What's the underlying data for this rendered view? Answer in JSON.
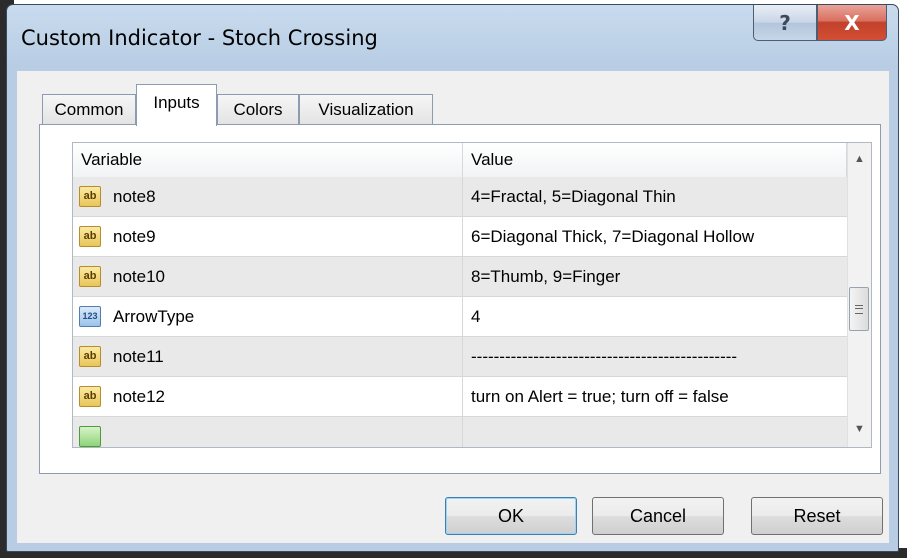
{
  "window": {
    "title": "Custom Indicator - Stoch Crossing",
    "help_glyph": "?",
    "close_glyph": "X"
  },
  "tabs": [
    {
      "label": "Common",
      "active": false
    },
    {
      "label": "Inputs",
      "active": true
    },
    {
      "label": "Colors",
      "active": false
    },
    {
      "label": "Visualization",
      "active": false
    }
  ],
  "table": {
    "headers": {
      "variable": "Variable",
      "value": "Value"
    },
    "rows": [
      {
        "type": "string",
        "icon": "ab",
        "variable": "note8",
        "value": "4=Fractal, 5=Diagonal Thin"
      },
      {
        "type": "string",
        "icon": "ab",
        "variable": "note9",
        "value": "6=Diagonal Thick, 7=Diagonal Hollow"
      },
      {
        "type": "string",
        "icon": "ab",
        "variable": "note10",
        "value": "8=Thumb, 9=Finger"
      },
      {
        "type": "integer",
        "icon": "123",
        "variable": "ArrowType",
        "value": "4"
      },
      {
        "type": "string",
        "icon": "ab",
        "variable": "note11",
        "value": "-----------------------------------------------"
      },
      {
        "type": "string",
        "icon": "ab",
        "variable": "note12",
        "value": "turn on Alert = true; turn off = false"
      },
      {
        "type": "bool",
        "icon": "",
        "variable": "",
        "value": ""
      }
    ]
  },
  "scrollbar": {
    "up_glyph": "▲",
    "down_glyph": "▼"
  },
  "buttons": {
    "ok": "OK",
    "cancel": "Cancel",
    "reset": "Reset"
  }
}
